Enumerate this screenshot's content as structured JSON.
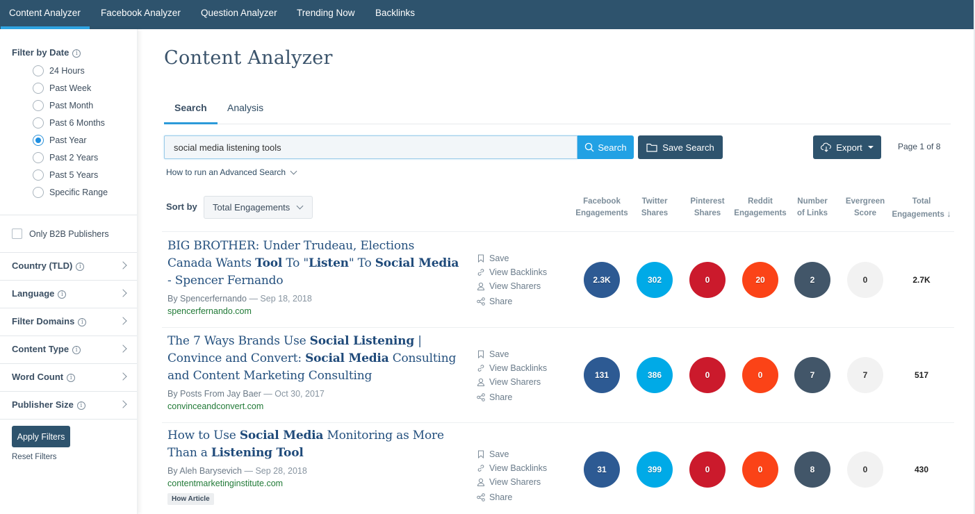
{
  "nav": {
    "tabs": [
      "Content Analyzer",
      "Facebook Analyzer",
      "Question Analyzer",
      "Trending Now",
      "Backlinks"
    ],
    "active": "Content Analyzer"
  },
  "sidebar": {
    "date_filter_title": "Filter by Date",
    "date_options": [
      "24 Hours",
      "Past Week",
      "Past Month",
      "Past 6 Months",
      "Past Year",
      "Past 2 Years",
      "Past 5 Years",
      "Specific Range"
    ],
    "selected_date": "Past Year",
    "b2b_label": "Only B2B Publishers",
    "b2b_checked": false,
    "sections": [
      "Country (TLD)",
      "Language",
      "Filter Domains",
      "Content Type",
      "Word Count",
      "Publisher Size"
    ],
    "apply_label": "Apply Filters",
    "reset_label": "Reset Filters"
  },
  "main": {
    "title": "Content Analyzer",
    "tabs": [
      "Search",
      "Analysis"
    ],
    "active_tab": "Search",
    "search_value": "social media listening tools",
    "search_button": "Search",
    "save_search_button": "Save Search",
    "export_button": "Export",
    "page_info": "Page 1 of 8",
    "advanced_search_link": "How to run an Advanced Search",
    "sort_label": "Sort by",
    "sort_value": "Total Engagements",
    "columns": [
      {
        "line1": "Facebook",
        "line2": "Engagements"
      },
      {
        "line1": "Twitter",
        "line2": "Shares"
      },
      {
        "line1": "Pinterest",
        "line2": "Shares"
      },
      {
        "line1": "Reddit",
        "line2": "Engagements"
      },
      {
        "line1": "Number",
        "line2": "of Links"
      },
      {
        "line1": "Evergreen",
        "line2": "Score"
      },
      {
        "line1": "Total",
        "line2": "Engagements",
        "sort_indicator": "↓"
      }
    ],
    "action_labels": {
      "save": "Save",
      "backlinks": "View Backlinks",
      "sharers": "View Sharers",
      "share": "Share"
    },
    "colors": {
      "facebook": "#2d5a93",
      "twitter": "#00aae7",
      "pinterest": "#cb1a2c",
      "reddit": "#fb4317",
      "links": "#425669",
      "evergreen": "#f2f2f2",
      "accent": "#22a1e4",
      "nav": "#2e536d"
    },
    "results": [
      {
        "title_parts": [
          {
            "t": "BIG BROTHER: Under Trudeau, Elections Canada Wants ",
            "b": false
          },
          {
            "t": "Tool",
            "b": true
          },
          {
            "t": " To \"",
            "b": false
          },
          {
            "t": "Listen",
            "b": true
          },
          {
            "t": "\" To ",
            "b": false
          },
          {
            "t": "Social Media",
            "b": true
          },
          {
            "t": " - Spencer Fernando",
            "b": false
          }
        ],
        "author": "By Spencerfernando",
        "date": "Sep 18, 2018",
        "domain": "spencerfernando.com",
        "badge": null,
        "metrics": {
          "facebook": "2.3K",
          "twitter": "302",
          "pinterest": "0",
          "reddit": "20",
          "links": "2",
          "evergreen": "0",
          "total": "2.7K"
        }
      },
      {
        "title_parts": [
          {
            "t": "The 7 Ways Brands Use ",
            "b": false
          },
          {
            "t": "Social Listening",
            "b": true
          },
          {
            "t": " | Convince and Convert: ",
            "b": false
          },
          {
            "t": "Social Media",
            "b": true
          },
          {
            "t": " Consulting and Content Marketing Consulting",
            "b": false
          }
        ],
        "author": "By Posts From Jay Baer",
        "date": "Oct 30, 2017",
        "domain": "convinceandconvert.com",
        "badge": null,
        "metrics": {
          "facebook": "131",
          "twitter": "386",
          "pinterest": "0",
          "reddit": "0",
          "links": "7",
          "evergreen": "7",
          "total": "517"
        }
      },
      {
        "title_parts": [
          {
            "t": "How to Use ",
            "b": false
          },
          {
            "t": "Social Media",
            "b": true
          },
          {
            "t": " Monitoring as More Than a ",
            "b": false
          },
          {
            "t": "Listening Tool",
            "b": true
          }
        ],
        "author": "By Aleh Barysevich",
        "date": "Sep 28, 2018",
        "domain": "contentmarketinginstitute.com",
        "badge": "How Article",
        "metrics": {
          "facebook": "31",
          "twitter": "399",
          "pinterest": "0",
          "reddit": "0",
          "links": "8",
          "evergreen": "0",
          "total": "430"
        }
      }
    ]
  }
}
